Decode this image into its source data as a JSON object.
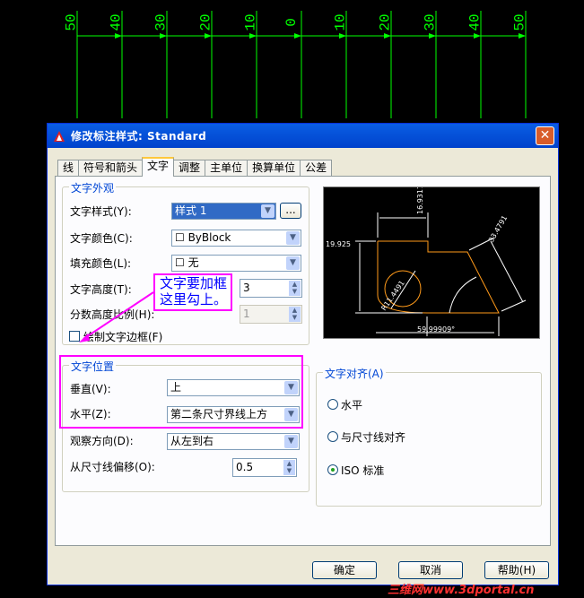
{
  "ruler": {
    "labels": [
      "50",
      "40",
      "30",
      "20",
      "10",
      "0",
      "10",
      "20",
      "30",
      "40",
      "50"
    ]
  },
  "dialog": {
    "title": "修改标注样式: Standard",
    "close": "✕",
    "tabs": [
      "线",
      "符号和箭头",
      "文字",
      "调整",
      "主单位",
      "换算单位",
      "公差"
    ],
    "active_tab": "文字",
    "text_appearance": {
      "group_title": "文字外观",
      "style_label": "文字样式(Y):",
      "style_value": "样式 1",
      "style_button": "...",
      "color_label": "文字颜色(C):",
      "color_value": "☐ ByBlock",
      "fill_label": "填充颜色(L):",
      "fill_value": "☐ 无",
      "height_label": "文字高度(T):",
      "height_value": "3",
      "scale_label": "分数高度比例(H):",
      "scale_value": "1",
      "frame_label": "绘制文字边框(F)"
    },
    "text_placement": {
      "group_title": "文字位置",
      "vertical_label": "垂直(V):",
      "vertical_value": "上",
      "horizontal_label": "水平(Z):",
      "horizontal_value": "第二条尺寸界线上方",
      "view_label": "观察方向(D):",
      "view_value": "从左到右",
      "offset_label": "从尺寸线偏移(O):",
      "offset_value": "0.5"
    },
    "text_alignment": {
      "group_title": "文字对齐(A)",
      "options": [
        "水平",
        "与尺寸线对齐",
        "ISO 标准"
      ],
      "selected": "ISO 标准"
    },
    "preview": {
      "dims": [
        "16.9317",
        "33.4791",
        "19.925",
        "59.99909°",
        "R11.4491"
      ]
    },
    "buttons": {
      "ok": "确定",
      "cancel": "取消",
      "help": "帮助(H)"
    }
  },
  "annotation": {
    "line1": "文字要加框",
    "line2": "这里勾上。"
  },
  "watermark": "三维网www.3dportal.cn",
  "colors": {
    "ruler": "#00ff00",
    "highlight": "#ff00ff",
    "annotation_text": "#0000ff"
  }
}
